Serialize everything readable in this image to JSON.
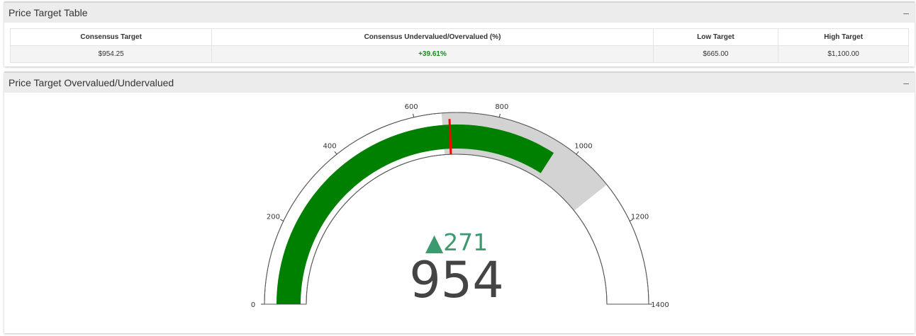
{
  "table_panel": {
    "title": "Price Target Table",
    "collapse": "–",
    "headers": [
      "Consensus Target",
      "Consensus Undervalued/Overvalued (%)",
      "Low Target",
      "High Target"
    ],
    "row": [
      "$954.25",
      "+39.61%",
      "$665.00",
      "$1,100.00"
    ]
  },
  "gauge_panel": {
    "title": "Price Target Overvalued/Undervalued",
    "collapse": "–"
  },
  "chart_data": {
    "type": "gauge",
    "value": 954,
    "display_value": "954",
    "delta": "271",
    "delta_symbol": "▲",
    "reference": 683,
    "range": [
      0,
      1400
    ],
    "ticks": [
      0,
      200,
      400,
      600,
      800,
      1000,
      1200,
      1400
    ],
    "step_band": [
      665,
      1100
    ],
    "threshold": 683,
    "colors": {
      "bar": "#008000",
      "band": "#d3d3d3",
      "threshold": "#ff0000",
      "delta": "#3d9970",
      "value": "#444444"
    }
  }
}
